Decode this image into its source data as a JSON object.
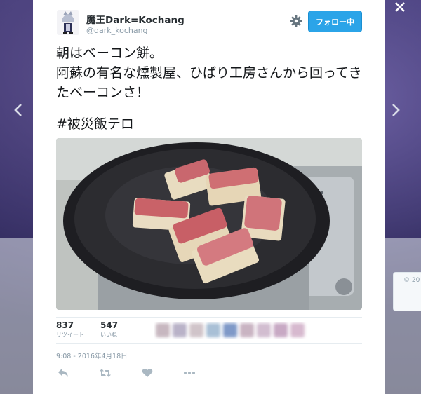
{
  "tweet": {
    "display_name": "魔王Dark=Kochang",
    "handle": "@dark_kochang",
    "follow_label": "フォロー中",
    "text": "朝はベーコン餅。\n阿蘇の有名な燻製屋、ひばり工房さんから回ってきたベーコンさ！",
    "hashtag": "#被災飯テロ",
    "photo_alt": "bacon-wrapped mochi frying in pan",
    "retweets": {
      "count": "837",
      "label": "リツイート"
    },
    "likes": {
      "count": "547",
      "label": "いいね"
    },
    "timestamp": "9:08 - 2016年4月18日"
  },
  "side_card": {
    "text": "© 20"
  },
  "icons": {
    "close": "close-icon",
    "prev": "chevron-left-icon",
    "next": "chevron-right-icon",
    "gear": "gear-icon",
    "reply": "reply-icon",
    "retweet": "retweet-icon",
    "like": "heart-icon",
    "more": "more-icon"
  },
  "colors": {
    "follow_button": "#2ba4e8",
    "muted_text": "#8899a6",
    "text": "#14171a"
  }
}
